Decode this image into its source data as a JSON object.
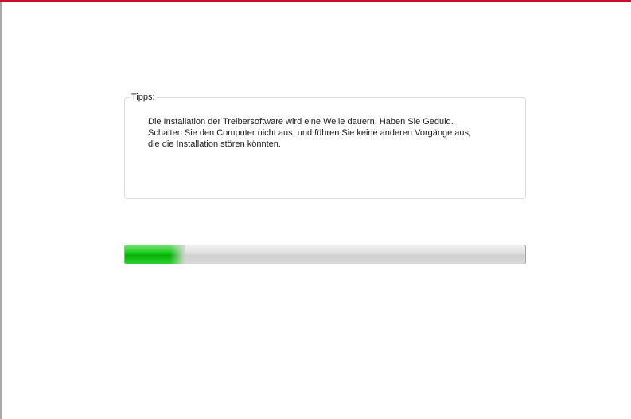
{
  "tips": {
    "legend": "Tipps:",
    "lines": [
      "Die Installation der Treibersoftware wird eine Weile dauern. Haben Sie Geduld.",
      "Schalten Sie den Computer nicht aus, und führen Sie keine anderen Vorgänge aus,",
      "die die Installation stören könnten."
    ]
  },
  "progress": {
    "fraction": 0.15
  },
  "colors": {
    "accent": "#c8102e",
    "progress_fill": "#11c411",
    "progress_track": "#dcdcdc"
  }
}
